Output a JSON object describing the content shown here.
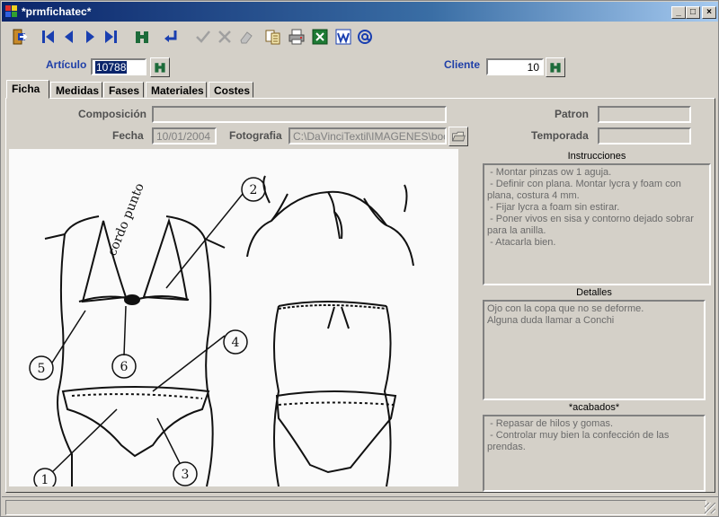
{
  "window": {
    "title": "*prmfichatec*",
    "minimize": "_",
    "maximize": "□",
    "close": "×"
  },
  "toolbar": {
    "buttons": [
      {
        "name": "exit-icon"
      },
      {
        "name": "first-record-icon"
      },
      {
        "name": "previous-record-icon"
      },
      {
        "name": "next-record-icon"
      },
      {
        "name": "last-record-icon"
      },
      {
        "name": "binoculars-icon"
      },
      {
        "name": "enter-icon"
      },
      {
        "name": "accept-icon"
      },
      {
        "name": "cancel-icon"
      },
      {
        "name": "eraser-icon"
      },
      {
        "name": "copy-icon"
      },
      {
        "name": "print-icon"
      },
      {
        "name": "excel-icon"
      },
      {
        "name": "word-icon"
      },
      {
        "name": "email-icon"
      }
    ]
  },
  "header": {
    "articulo_label": "Artículo",
    "articulo_value": "10788",
    "cliente_label": "Cliente",
    "cliente_value": "10"
  },
  "tabs": [
    "Ficha",
    "Medidas",
    "Fases",
    "Materiales",
    "Costes"
  ],
  "ficha": {
    "composicion_label": "Composición",
    "composicion_value": "",
    "fecha_label": "Fecha",
    "fecha_value": "10/01/2004",
    "fotografia_label": "Fotografia",
    "fotografia_value": "C:\\DaVinciTextil\\IMAGENES\\bocet",
    "patron_label": "Patron",
    "patron_value": "",
    "temporada_label": "Temporada",
    "temporada_value": "",
    "instrucciones_label": "Instrucciones",
    "instrucciones_text": " - Montar pinzas ow 1 aguja.\n - Definir con plana. Montar lycra y foam con plana, costura 4 mm.\n - Fijar lycra a foam sin estirar.\n - Poner vivos en sisa y contorno dejado sobrar para la anilla.\n - Atacarla bien.",
    "detalles_label": "Detalles",
    "detalles_text": "Ojo con la copa que no se deforme.\nAlguna duda llamar a Conchi",
    "acabados_label": "*acabados*",
    "acabados_text": " - Repasar de hilos y gomas.\n - Controlar muy bien la confección de las prendas."
  },
  "sketch": {
    "annotation": "cordo punto",
    "callouts": [
      "2",
      "4",
      "5",
      "6",
      "3",
      "1"
    ]
  },
  "colors": {
    "label_blue": "#1f3fa8",
    "title_dark": "#0a246a",
    "face": "#d4d0c8"
  }
}
